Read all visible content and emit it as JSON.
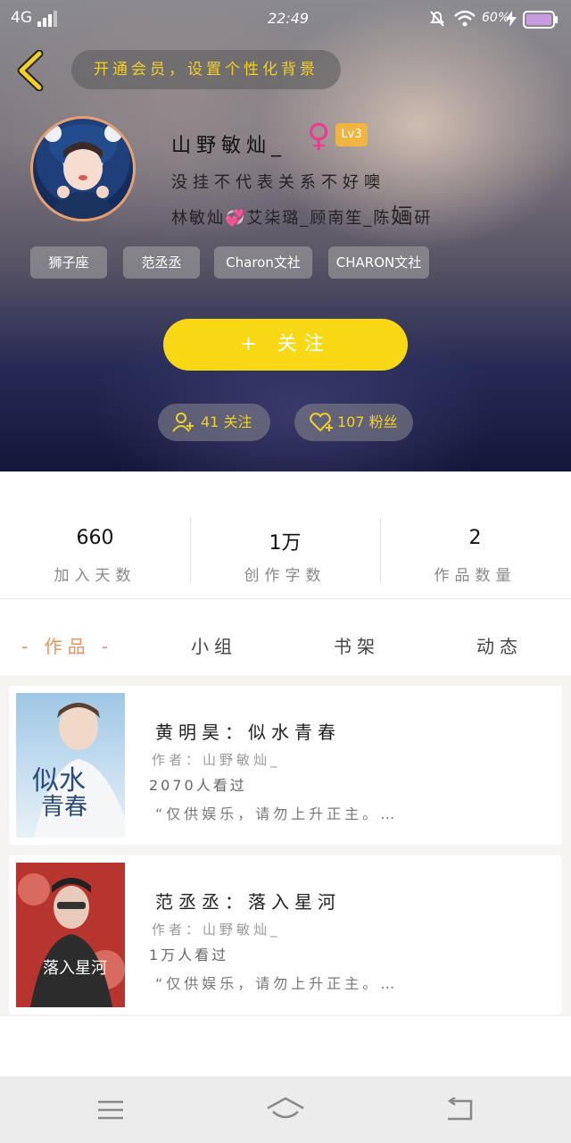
{
  "status_bar": {
    "network": "4G",
    "time": "22:49",
    "battery": "60%"
  },
  "header": {
    "vip_banner": "开通会员，设置个性化背景",
    "name": "山野敏灿_",
    "level": "Lv3",
    "bio_line1": "没挂不代表关系不好噢",
    "bio_line2_a": "林敏灿",
    "bio_line2_b": "艾柒璐_顾南笙_陈",
    "bio_line2_c": "婳",
    "bio_line2_d": "研",
    "tags": [
      "狮子座",
      "范丞丞",
      "Charon文社",
      "CHARON文社"
    ],
    "follow_label": "+ 关注",
    "following_count": "41",
    "following_label": "关注",
    "fans_count": "107",
    "fans_label": "粉丝"
  },
  "stats": [
    {
      "value": "660",
      "label": "加入天数"
    },
    {
      "value": "1万",
      "label": "创作字数"
    },
    {
      "value": "2",
      "label": "作品数量"
    }
  ],
  "tabs": [
    {
      "label": "- 作品 -",
      "active": true
    },
    {
      "label": "小组"
    },
    {
      "label": "书架"
    },
    {
      "label": "动态"
    }
  ],
  "works": [
    {
      "title": "黄明昊：似水青春",
      "author": "作者：山野敏灿_",
      "views": "2070人看过",
      "desc": "“仅供娱乐，请勿上升正主。…",
      "cover_text": "似水青春"
    },
    {
      "title": "范丞丞：落入星河",
      "author": "作者：山野敏灿_",
      "views": "1万人看过",
      "desc": "“仅供娱乐，请勿上升正主。…",
      "cover_text": "落入星河"
    }
  ],
  "colors": {
    "accent_yellow": "#f8d715",
    "tab_active": "#e8925a",
    "gender_pink": "#ea3b8d"
  }
}
